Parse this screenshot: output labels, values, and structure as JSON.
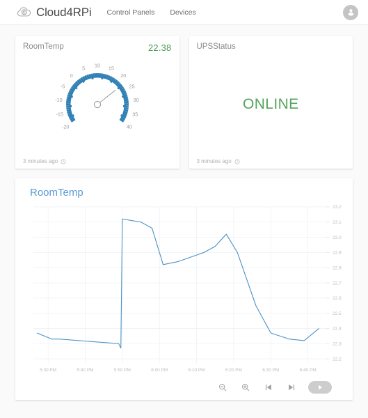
{
  "header": {
    "logo_icon": "cloud-logo-icon",
    "brand_title": "Cloud4RPi",
    "nav": [
      {
        "label": "Control Panels"
      },
      {
        "label": "Devices"
      }
    ],
    "avatar_icon": "account-circle-icon"
  },
  "widgets": [
    {
      "title": "RoomTemp",
      "value": "22.38",
      "value_color": "#4f9c5a",
      "type": "gauge",
      "footer": "3 minutes ago",
      "footer_icon": "clock-icon",
      "gauge": {
        "min": -20,
        "max": 40,
        "value": 22.38,
        "tick_labels": [
          "-20",
          "-15",
          "-10",
          "-5",
          "0",
          "5",
          "10",
          "15",
          "20",
          "25",
          "30",
          "35",
          "40"
        ],
        "arc_color": "#2f7fb5",
        "needle_color": "#9e9e9e"
      }
    },
    {
      "title": "UPSStatus",
      "value": "",
      "type": "status",
      "status_text": "ONLINE",
      "status_color": "#55a35c",
      "footer": "3 minutes ago",
      "footer_icon": "clock-icon"
    }
  ],
  "chart_card": {
    "title": "RoomTemp",
    "title_color": "#5b9bd5",
    "toolbar": [
      {
        "name": "zoom-out-button",
        "icon": "magnify-minus-icon"
      },
      {
        "name": "zoom-in-button",
        "icon": "magnify-plus-icon"
      },
      {
        "name": "skip-previous-button",
        "icon": "skip-previous-icon"
      },
      {
        "name": "skip-next-button",
        "icon": "skip-next-icon"
      },
      {
        "name": "play-button",
        "icon": "play-icon"
      }
    ]
  },
  "chart_data": {
    "type": "line",
    "title": "RoomTemp",
    "xlabel": "",
    "ylabel": "",
    "grid": true,
    "legend": false,
    "line_color": "#4a90c4",
    "ylim": [
      22.2,
      23.2
    ],
    "ytick_labels": [
      "23.2",
      "23.1",
      "23.0",
      "22.9",
      "22.8",
      "22.7",
      "22.6",
      "22.5",
      "22.4",
      "22.3",
      "22.2"
    ],
    "yticks": [
      23.2,
      23.1,
      23.0,
      22.9,
      22.8,
      22.7,
      22.6,
      22.5,
      22.4,
      22.3,
      22.2
    ],
    "xtick_labels": [
      "5:30 PM",
      "5:40 PM",
      "5:50 PM",
      "6:00 PM",
      "6:10 PM",
      "6:20 PM",
      "6:30 PM",
      "6:40 PM"
    ],
    "xticks_minutes": [
      330,
      340,
      350,
      360,
      370,
      380,
      390,
      400
    ],
    "xlim_minutes": [
      326,
      405
    ],
    "series": [
      {
        "name": "RoomTemp",
        "x_minutes": [
          327,
          331,
          333,
          349,
          349.6,
          350,
          355,
          358,
          361,
          365,
          372,
          375,
          378,
          381,
          386,
          390,
          395,
          399,
          403
        ],
        "values": [
          22.37,
          22.33,
          22.33,
          22.3,
          22.27,
          23.12,
          23.1,
          23.06,
          22.82,
          22.84,
          22.9,
          22.94,
          23.02,
          22.9,
          22.55,
          22.37,
          22.33,
          22.32,
          22.4
        ]
      }
    ]
  }
}
